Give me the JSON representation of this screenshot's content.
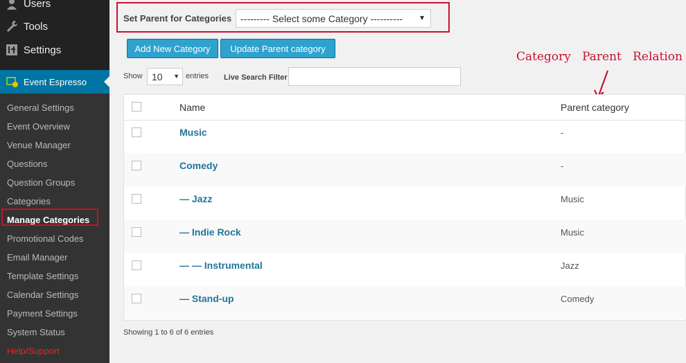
{
  "sidebar": {
    "top_items": [
      {
        "label": "Users",
        "icon": "users-icon"
      },
      {
        "label": "Tools",
        "icon": "wrench-icon"
      },
      {
        "label": "Settings",
        "icon": "settings-icon"
      }
    ],
    "active_menu": {
      "label": "Event Espresso",
      "icon": "event-espresso-icon"
    },
    "submenu": [
      "General Settings",
      "Event Overview",
      "Venue Manager",
      "Questions",
      "Question Groups",
      "Categories",
      "Manage Categories",
      "Promotional Codes",
      "Email Manager",
      "Template Settings",
      "Calendar Settings",
      "Payment Settings",
      "System Status",
      "Help/Support"
    ]
  },
  "parent_selector": {
    "label": "Set Parent for Categories",
    "selected": "--------- Select some Category ----------"
  },
  "buttons": {
    "add": "Add New Category",
    "update": "Update Parent category"
  },
  "annotation": "Category   Parent   Relation",
  "controls": {
    "show": "Show",
    "length": "10",
    "entries": "entries",
    "search_label": "Live Search Filter",
    "search_value": ""
  },
  "table": {
    "headers": {
      "name": "Name",
      "parent": "Parent category"
    },
    "rows": [
      {
        "name": "Music",
        "parent": "-"
      },
      {
        "name": "Comedy",
        "parent": "-"
      },
      {
        "name": "— Jazz",
        "parent": "Music"
      },
      {
        "name": "— Indie Rock",
        "parent": "Music"
      },
      {
        "name": "— — Instrumental",
        "parent": "Jazz"
      },
      {
        "name": "— Stand-up",
        "parent": "Comedy"
      }
    ]
  },
  "footer": "Showing 1 to 6 of 6 entries",
  "colors": {
    "accent": "#0074a2",
    "button": "#2ea2cc",
    "highlight": "#c8102e",
    "link": "#21759b"
  }
}
